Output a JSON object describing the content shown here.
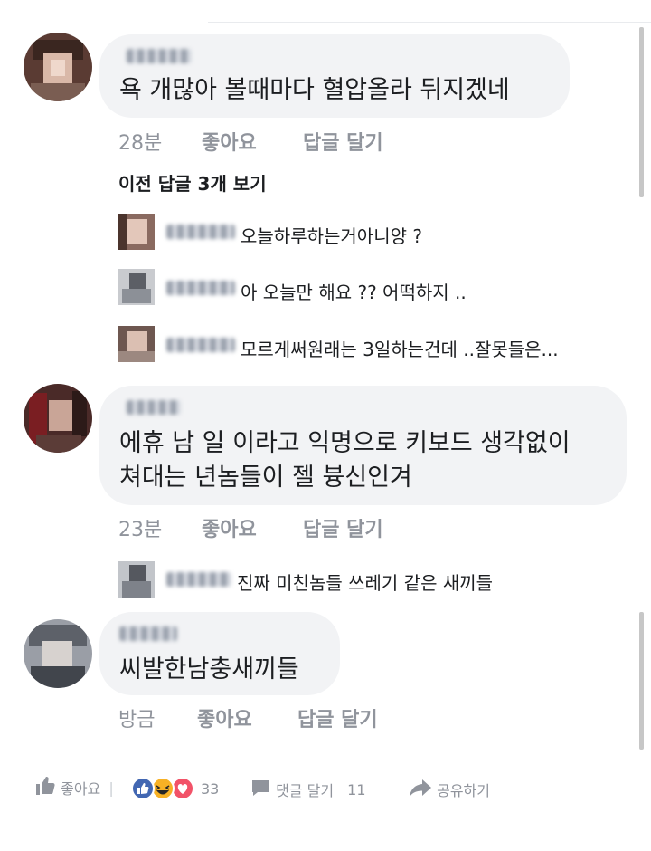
{
  "comments": [
    {
      "text": "욕 개많아 볼때마다 혈압올라 뒤지겠네",
      "time": "28분",
      "like_label": "좋아요",
      "reply_label": "답글 달기",
      "view_previous": "이전 답글 3개 보기",
      "replies": [
        {
          "text": "오늘하루하는거아니양 ?"
        },
        {
          "text": "아 오늘만 해요 ?? 어떡하지 .."
        },
        {
          "text": "모르게써원래는 3일하는건데 ..잘못들은..."
        }
      ]
    },
    {
      "text_line1": "에휴 남 일 이라고 익명으로 키보드 생각없이",
      "text_line2": "쳐대는 년놈들이 젤 븅신인겨",
      "time": "23분",
      "like_label": "좋아요",
      "reply_label": "답글 달기",
      "replies": [
        {
          "text": "진짜 미친놈들 쓰레기 같은 새끼들"
        }
      ]
    },
    {
      "text": "씨발한남충새끼들",
      "time": "방금",
      "like_label": "좋아요",
      "reply_label": "답글 달기"
    }
  ],
  "footer": {
    "like_label": "좋아요",
    "reaction_count": "33",
    "comment_label": "댓글 달기",
    "comment_count": "11",
    "share_label": "공유하기"
  },
  "colors": {
    "bubble": "#f2f3f5",
    "meta_text": "#90949c",
    "text": "#1c1e21",
    "like_blue": "#4267b2",
    "haha_yellow": "#f7b125",
    "love_red": "#f25268"
  },
  "icons": [
    "thumbs-up-icon",
    "like-reaction-icon",
    "haha-reaction-icon",
    "love-reaction-icon",
    "comment-icon",
    "share-arrow-icon"
  ]
}
